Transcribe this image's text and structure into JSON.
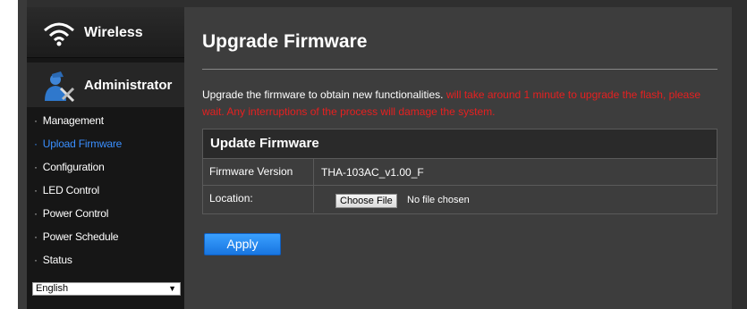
{
  "sidebar": {
    "wireless_label": "Wireless",
    "administrator_label": "Administrator",
    "items": [
      {
        "label": "Management"
      },
      {
        "label": "Upload Firmware",
        "active": true
      },
      {
        "label": "Configuration"
      },
      {
        "label": "LED Control"
      },
      {
        "label": "Power Control"
      },
      {
        "label": "Power Schedule"
      },
      {
        "label": "Status"
      }
    ],
    "language": "English"
  },
  "main": {
    "title": "Upgrade Firmware",
    "description": "Upgrade the firmware to obtain new functionalities.",
    "warning": "will take around 1 minute to upgrade the flash, please wait. Any interruptions of the process will damage the system.",
    "panel": {
      "title": "Update Firmware",
      "firmware_version_label": "Firmware Version",
      "firmware_version_value": "THA-103AC_v1.00_F",
      "location_label": "Location:",
      "choose_file_label": "Choose File",
      "no_file_text": "No file chosen"
    },
    "apply_label": "Apply"
  },
  "colors": {
    "accent": "#3a8fff",
    "warning": "#e62020",
    "button": "#1f86f0"
  }
}
